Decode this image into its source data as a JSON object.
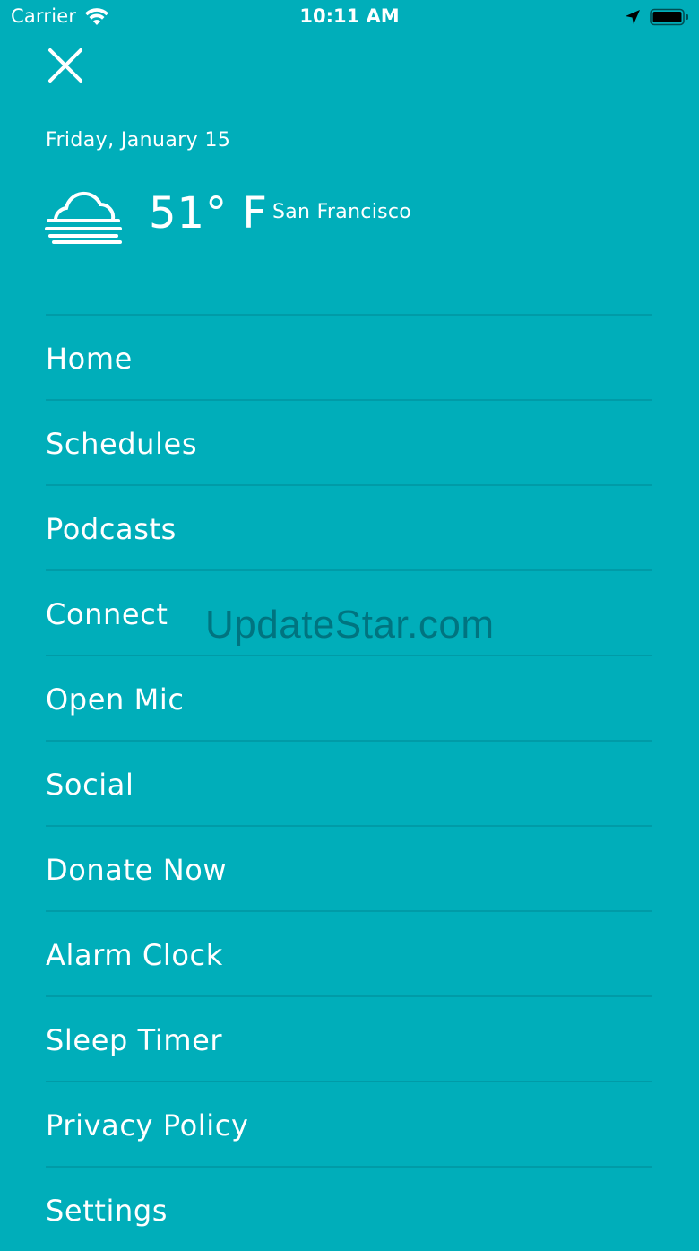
{
  "status_bar": {
    "carrier": "Carrier",
    "time": "10:11 AM"
  },
  "header": {
    "date": "Friday, January 15",
    "temperature": "51° F",
    "city": "San Francisco",
    "weather_icon": "fog-cloud-icon"
  },
  "menu": {
    "items": [
      {
        "label": "Home"
      },
      {
        "label": "Schedules"
      },
      {
        "label": "Podcasts"
      },
      {
        "label": "Connect"
      },
      {
        "label": "Open Mic"
      },
      {
        "label": "Social"
      },
      {
        "label": "Donate Now"
      },
      {
        "label": "Alarm Clock"
      },
      {
        "label": "Sleep Timer"
      },
      {
        "label": "Privacy Policy"
      },
      {
        "label": "Settings"
      }
    ]
  },
  "watermark": "UpdateStar.com",
  "colors": {
    "background": "#00AEBA",
    "text": "#FFFFFF"
  }
}
